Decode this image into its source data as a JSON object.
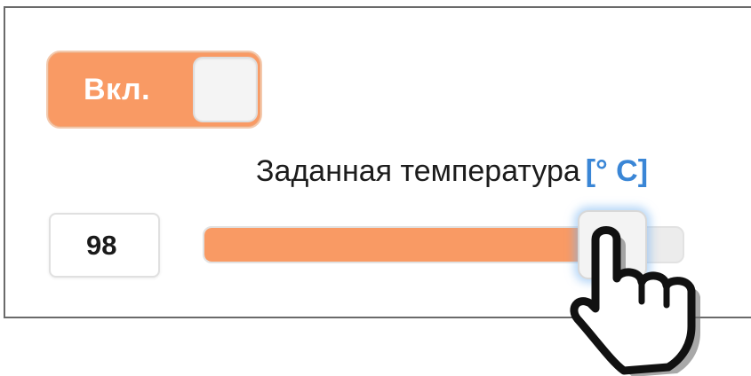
{
  "toggle": {
    "label": "Вкл.",
    "state": "on"
  },
  "temperature": {
    "caption": "Заданная температура",
    "unit": "[° C]",
    "value": "98",
    "slider_fraction": 0.84
  },
  "colors": {
    "accent": "#f99a64",
    "unit_text": "#3a86d6",
    "thumb_glow": "#78b4f0"
  },
  "icons": {
    "cursor": "hand-pointer-icon"
  }
}
